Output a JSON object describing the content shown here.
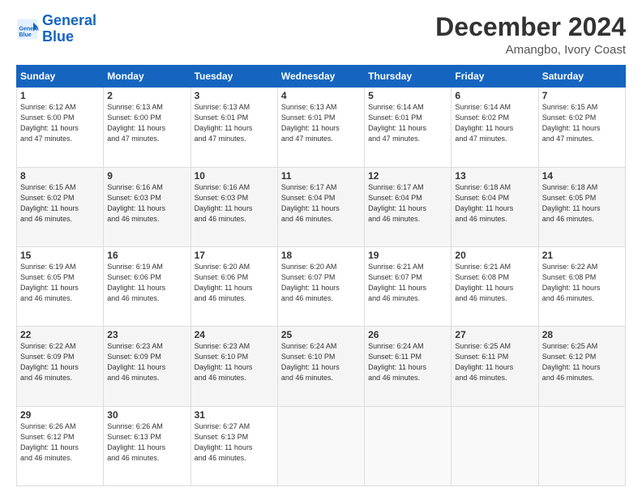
{
  "logo": {
    "line1": "General",
    "line2": "Blue"
  },
  "title": "December 2024",
  "subtitle": "Amangbo, Ivory Coast",
  "days_header": [
    "Sunday",
    "Monday",
    "Tuesday",
    "Wednesday",
    "Thursday",
    "Friday",
    "Saturday"
  ],
  "weeks": [
    [
      {
        "day": "1",
        "info": "Sunrise: 6:12 AM\nSunset: 6:00 PM\nDaylight: 11 hours\nand 47 minutes."
      },
      {
        "day": "2",
        "info": "Sunrise: 6:13 AM\nSunset: 6:00 PM\nDaylight: 11 hours\nand 47 minutes."
      },
      {
        "day": "3",
        "info": "Sunrise: 6:13 AM\nSunset: 6:01 PM\nDaylight: 11 hours\nand 47 minutes."
      },
      {
        "day": "4",
        "info": "Sunrise: 6:13 AM\nSunset: 6:01 PM\nDaylight: 11 hours\nand 47 minutes."
      },
      {
        "day": "5",
        "info": "Sunrise: 6:14 AM\nSunset: 6:01 PM\nDaylight: 11 hours\nand 47 minutes."
      },
      {
        "day": "6",
        "info": "Sunrise: 6:14 AM\nSunset: 6:02 PM\nDaylight: 11 hours\nand 47 minutes."
      },
      {
        "day": "7",
        "info": "Sunrise: 6:15 AM\nSunset: 6:02 PM\nDaylight: 11 hours\nand 47 minutes."
      }
    ],
    [
      {
        "day": "8",
        "info": "Sunrise: 6:15 AM\nSunset: 6:02 PM\nDaylight: 11 hours\nand 46 minutes."
      },
      {
        "day": "9",
        "info": "Sunrise: 6:16 AM\nSunset: 6:03 PM\nDaylight: 11 hours\nand 46 minutes."
      },
      {
        "day": "10",
        "info": "Sunrise: 6:16 AM\nSunset: 6:03 PM\nDaylight: 11 hours\nand 46 minutes."
      },
      {
        "day": "11",
        "info": "Sunrise: 6:17 AM\nSunset: 6:04 PM\nDaylight: 11 hours\nand 46 minutes."
      },
      {
        "day": "12",
        "info": "Sunrise: 6:17 AM\nSunset: 6:04 PM\nDaylight: 11 hours\nand 46 minutes."
      },
      {
        "day": "13",
        "info": "Sunrise: 6:18 AM\nSunset: 6:04 PM\nDaylight: 11 hours\nand 46 minutes."
      },
      {
        "day": "14",
        "info": "Sunrise: 6:18 AM\nSunset: 6:05 PM\nDaylight: 11 hours\nand 46 minutes."
      }
    ],
    [
      {
        "day": "15",
        "info": "Sunrise: 6:19 AM\nSunset: 6:05 PM\nDaylight: 11 hours\nand 46 minutes."
      },
      {
        "day": "16",
        "info": "Sunrise: 6:19 AM\nSunset: 6:06 PM\nDaylight: 11 hours\nand 46 minutes."
      },
      {
        "day": "17",
        "info": "Sunrise: 6:20 AM\nSunset: 6:06 PM\nDaylight: 11 hours\nand 46 minutes."
      },
      {
        "day": "18",
        "info": "Sunrise: 6:20 AM\nSunset: 6:07 PM\nDaylight: 11 hours\nand 46 minutes."
      },
      {
        "day": "19",
        "info": "Sunrise: 6:21 AM\nSunset: 6:07 PM\nDaylight: 11 hours\nand 46 minutes."
      },
      {
        "day": "20",
        "info": "Sunrise: 6:21 AM\nSunset: 6:08 PM\nDaylight: 11 hours\nand 46 minutes."
      },
      {
        "day": "21",
        "info": "Sunrise: 6:22 AM\nSunset: 6:08 PM\nDaylight: 11 hours\nand 46 minutes."
      }
    ],
    [
      {
        "day": "22",
        "info": "Sunrise: 6:22 AM\nSunset: 6:09 PM\nDaylight: 11 hours\nand 46 minutes."
      },
      {
        "day": "23",
        "info": "Sunrise: 6:23 AM\nSunset: 6:09 PM\nDaylight: 11 hours\nand 46 minutes."
      },
      {
        "day": "24",
        "info": "Sunrise: 6:23 AM\nSunset: 6:10 PM\nDaylight: 11 hours\nand 46 minutes."
      },
      {
        "day": "25",
        "info": "Sunrise: 6:24 AM\nSunset: 6:10 PM\nDaylight: 11 hours\nand 46 minutes."
      },
      {
        "day": "26",
        "info": "Sunrise: 6:24 AM\nSunset: 6:11 PM\nDaylight: 11 hours\nand 46 minutes."
      },
      {
        "day": "27",
        "info": "Sunrise: 6:25 AM\nSunset: 6:11 PM\nDaylight: 11 hours\nand 46 minutes."
      },
      {
        "day": "28",
        "info": "Sunrise: 6:25 AM\nSunset: 6:12 PM\nDaylight: 11 hours\nand 46 minutes."
      }
    ],
    [
      {
        "day": "29",
        "info": "Sunrise: 6:26 AM\nSunset: 6:12 PM\nDaylight: 11 hours\nand 46 minutes."
      },
      {
        "day": "30",
        "info": "Sunrise: 6:26 AM\nSunset: 6:13 PM\nDaylight: 11 hours\nand 46 minutes."
      },
      {
        "day": "31",
        "info": "Sunrise: 6:27 AM\nSunset: 6:13 PM\nDaylight: 11 hours\nand 46 minutes."
      },
      null,
      null,
      null,
      null
    ]
  ]
}
